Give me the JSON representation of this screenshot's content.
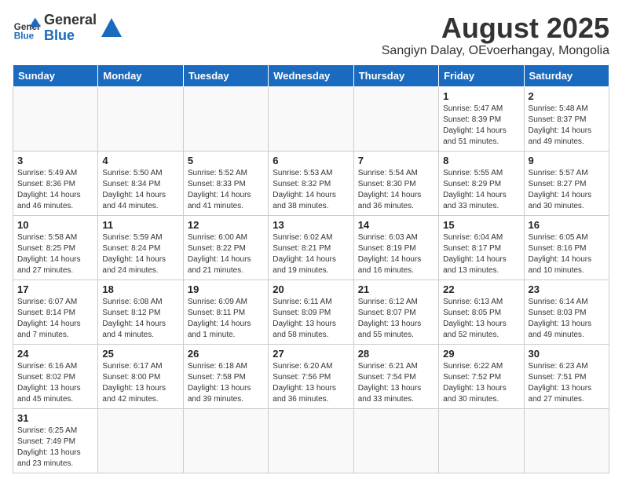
{
  "header": {
    "logo_general": "General",
    "logo_blue": "Blue",
    "title": "August 2025",
    "subtitle": "Sangiyn Dalay, OEvoerhangay, Mongolia"
  },
  "weekdays": [
    "Sunday",
    "Monday",
    "Tuesday",
    "Wednesday",
    "Thursday",
    "Friday",
    "Saturday"
  ],
  "weeks": [
    [
      {
        "day": "",
        "info": ""
      },
      {
        "day": "",
        "info": ""
      },
      {
        "day": "",
        "info": ""
      },
      {
        "day": "",
        "info": ""
      },
      {
        "day": "",
        "info": ""
      },
      {
        "day": "1",
        "info": "Sunrise: 5:47 AM\nSunset: 8:39 PM\nDaylight: 14 hours and 51 minutes."
      },
      {
        "day": "2",
        "info": "Sunrise: 5:48 AM\nSunset: 8:37 PM\nDaylight: 14 hours and 49 minutes."
      }
    ],
    [
      {
        "day": "3",
        "info": "Sunrise: 5:49 AM\nSunset: 8:36 PM\nDaylight: 14 hours and 46 minutes."
      },
      {
        "day": "4",
        "info": "Sunrise: 5:50 AM\nSunset: 8:34 PM\nDaylight: 14 hours and 44 minutes."
      },
      {
        "day": "5",
        "info": "Sunrise: 5:52 AM\nSunset: 8:33 PM\nDaylight: 14 hours and 41 minutes."
      },
      {
        "day": "6",
        "info": "Sunrise: 5:53 AM\nSunset: 8:32 PM\nDaylight: 14 hours and 38 minutes."
      },
      {
        "day": "7",
        "info": "Sunrise: 5:54 AM\nSunset: 8:30 PM\nDaylight: 14 hours and 36 minutes."
      },
      {
        "day": "8",
        "info": "Sunrise: 5:55 AM\nSunset: 8:29 PM\nDaylight: 14 hours and 33 minutes."
      },
      {
        "day": "9",
        "info": "Sunrise: 5:57 AM\nSunset: 8:27 PM\nDaylight: 14 hours and 30 minutes."
      }
    ],
    [
      {
        "day": "10",
        "info": "Sunrise: 5:58 AM\nSunset: 8:25 PM\nDaylight: 14 hours and 27 minutes."
      },
      {
        "day": "11",
        "info": "Sunrise: 5:59 AM\nSunset: 8:24 PM\nDaylight: 14 hours and 24 minutes."
      },
      {
        "day": "12",
        "info": "Sunrise: 6:00 AM\nSunset: 8:22 PM\nDaylight: 14 hours and 21 minutes."
      },
      {
        "day": "13",
        "info": "Sunrise: 6:02 AM\nSunset: 8:21 PM\nDaylight: 14 hours and 19 minutes."
      },
      {
        "day": "14",
        "info": "Sunrise: 6:03 AM\nSunset: 8:19 PM\nDaylight: 14 hours and 16 minutes."
      },
      {
        "day": "15",
        "info": "Sunrise: 6:04 AM\nSunset: 8:17 PM\nDaylight: 14 hours and 13 minutes."
      },
      {
        "day": "16",
        "info": "Sunrise: 6:05 AM\nSunset: 8:16 PM\nDaylight: 14 hours and 10 minutes."
      }
    ],
    [
      {
        "day": "17",
        "info": "Sunrise: 6:07 AM\nSunset: 8:14 PM\nDaylight: 14 hours and 7 minutes."
      },
      {
        "day": "18",
        "info": "Sunrise: 6:08 AM\nSunset: 8:12 PM\nDaylight: 14 hours and 4 minutes."
      },
      {
        "day": "19",
        "info": "Sunrise: 6:09 AM\nSunset: 8:11 PM\nDaylight: 14 hours and 1 minute."
      },
      {
        "day": "20",
        "info": "Sunrise: 6:11 AM\nSunset: 8:09 PM\nDaylight: 13 hours and 58 minutes."
      },
      {
        "day": "21",
        "info": "Sunrise: 6:12 AM\nSunset: 8:07 PM\nDaylight: 13 hours and 55 minutes."
      },
      {
        "day": "22",
        "info": "Sunrise: 6:13 AM\nSunset: 8:05 PM\nDaylight: 13 hours and 52 minutes."
      },
      {
        "day": "23",
        "info": "Sunrise: 6:14 AM\nSunset: 8:03 PM\nDaylight: 13 hours and 49 minutes."
      }
    ],
    [
      {
        "day": "24",
        "info": "Sunrise: 6:16 AM\nSunset: 8:02 PM\nDaylight: 13 hours and 45 minutes."
      },
      {
        "day": "25",
        "info": "Sunrise: 6:17 AM\nSunset: 8:00 PM\nDaylight: 13 hours and 42 minutes."
      },
      {
        "day": "26",
        "info": "Sunrise: 6:18 AM\nSunset: 7:58 PM\nDaylight: 13 hours and 39 minutes."
      },
      {
        "day": "27",
        "info": "Sunrise: 6:20 AM\nSunset: 7:56 PM\nDaylight: 13 hours and 36 minutes."
      },
      {
        "day": "28",
        "info": "Sunrise: 6:21 AM\nSunset: 7:54 PM\nDaylight: 13 hours and 33 minutes."
      },
      {
        "day": "29",
        "info": "Sunrise: 6:22 AM\nSunset: 7:52 PM\nDaylight: 13 hours and 30 minutes."
      },
      {
        "day": "30",
        "info": "Sunrise: 6:23 AM\nSunset: 7:51 PM\nDaylight: 13 hours and 27 minutes."
      }
    ],
    [
      {
        "day": "31",
        "info": "Sunrise: 6:25 AM\nSunset: 7:49 PM\nDaylight: 13 hours and 23 minutes."
      },
      {
        "day": "",
        "info": ""
      },
      {
        "day": "",
        "info": ""
      },
      {
        "day": "",
        "info": ""
      },
      {
        "day": "",
        "info": ""
      },
      {
        "day": "",
        "info": ""
      },
      {
        "day": "",
        "info": ""
      }
    ]
  ]
}
